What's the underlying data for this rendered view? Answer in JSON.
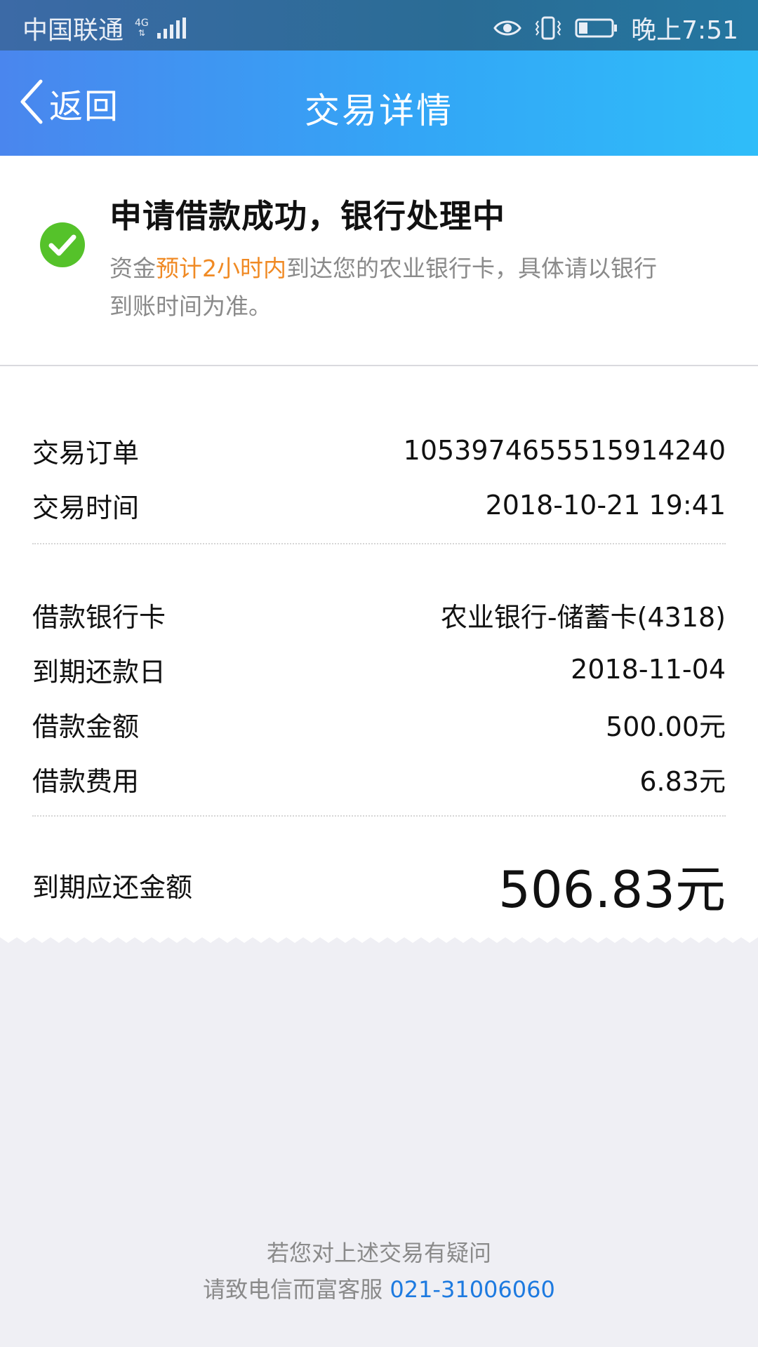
{
  "status_bar": {
    "carrier": "中国联通",
    "network_type": "4G",
    "time": "晚上7:51",
    "icons": [
      "signal-icon",
      "eye-icon",
      "vibrate-icon",
      "battery-icon"
    ]
  },
  "header": {
    "back_label": "返回",
    "title": "交易详情"
  },
  "status": {
    "title": "申请借款成功，银行处理中",
    "desc_prefix": "资金",
    "desc_highlight": "预计2小时内",
    "desc_suffix": "到达您的农业银行卡，具体请以银行到账时间为准。",
    "icon": "check-circle-icon"
  },
  "transaction": {
    "order_label": "交易订单",
    "order_value": "1053974655515914240",
    "time_label": "交易时间",
    "time_value": "2018-10-21 19:41"
  },
  "loan": {
    "card_label": "借款银行卡",
    "card_value": "农业银行-储蓄卡(4318)",
    "due_label": "到期还款日",
    "due_value": "2018-11-04",
    "amount_label": "借款金额",
    "amount_value": "500.00元",
    "fee_label": "借款费用",
    "fee_value": "6.83元"
  },
  "total": {
    "label": "到期应还金额",
    "value": "506.83元"
  },
  "footer": {
    "line1": "若您对上述交易有疑问",
    "line2_prefix": "请致电信而富客服 ",
    "phone": "021-31006060"
  },
  "colors": {
    "header_start": "#4a86ee",
    "header_end": "#2fbdf9",
    "success_green": "#55c22a",
    "highlight_orange": "#f08a24",
    "link_blue": "#1d7ae0"
  }
}
